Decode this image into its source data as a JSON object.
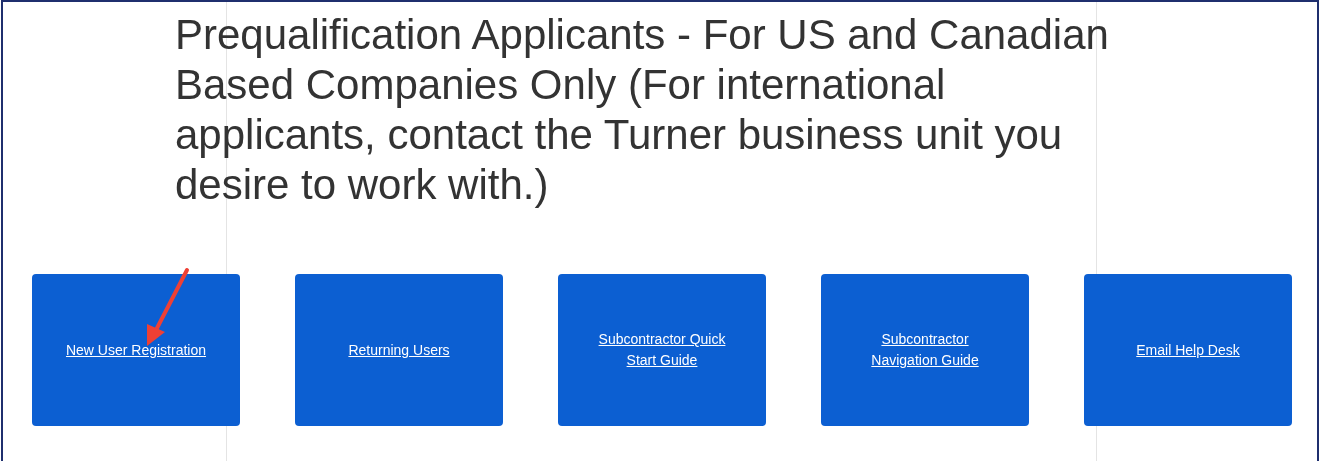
{
  "heading": "Prequalification Applicants - For US and Canadian Based Companies Only (For international applicants, contact the Turner business unit you desire to work with.)",
  "tiles": [
    {
      "label": "New User Registration"
    },
    {
      "label": "Returning Users"
    },
    {
      "label": "Subcontractor Quick Start Guide"
    },
    {
      "label": "Subcontractor Navigation Guide"
    },
    {
      "label": "Email Help Desk"
    }
  ]
}
